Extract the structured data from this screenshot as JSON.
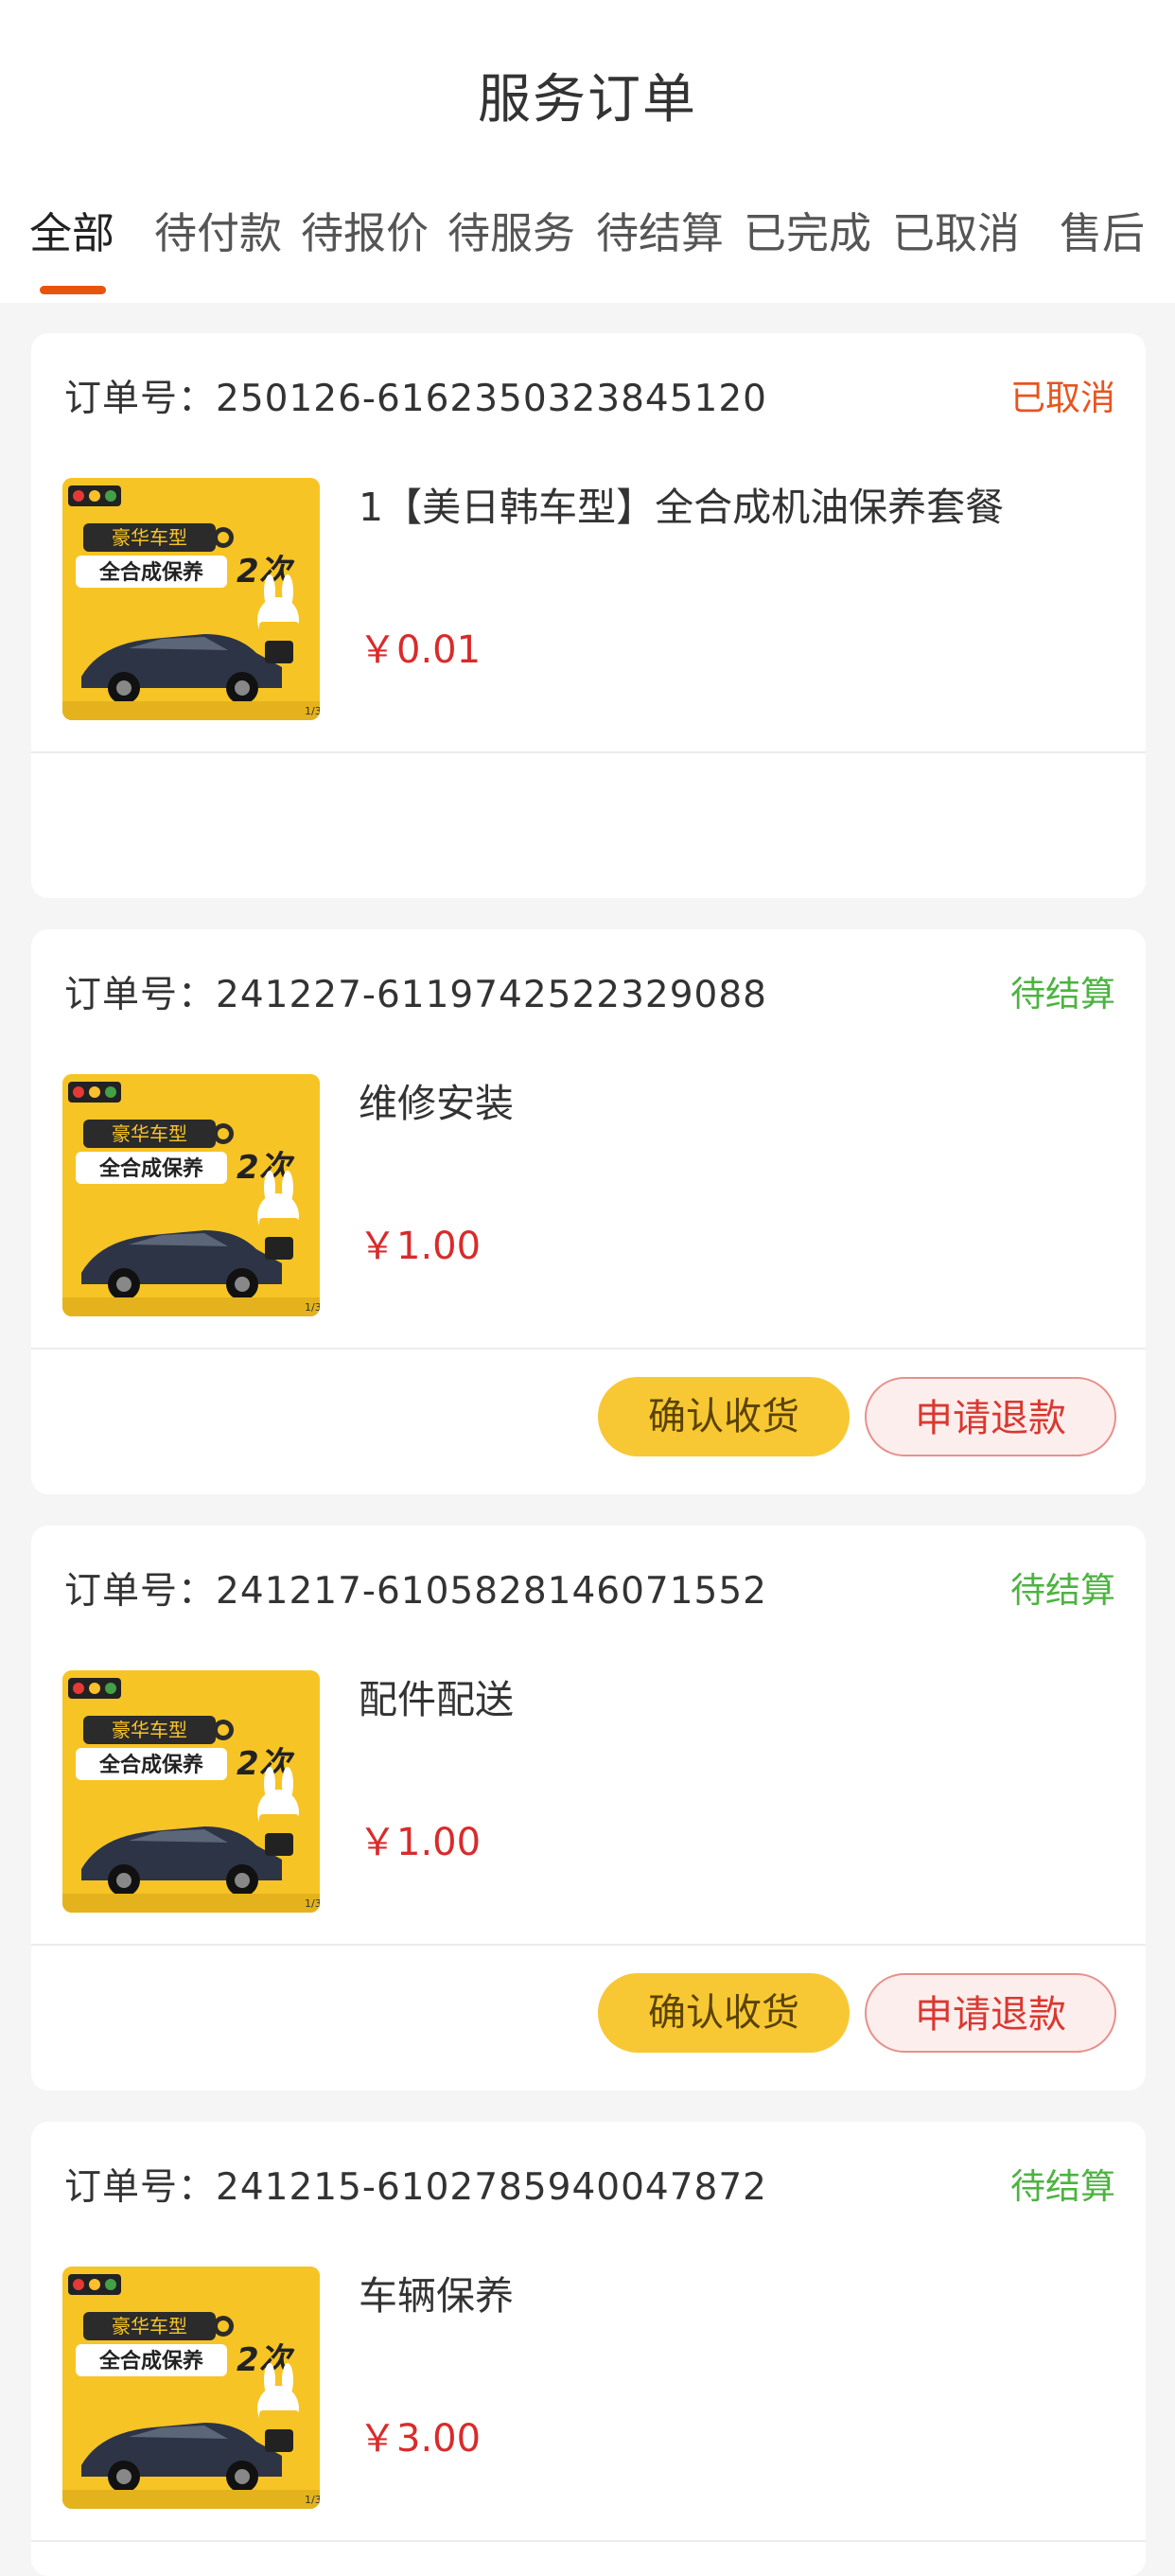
{
  "header": {
    "title": "服务订单"
  },
  "tabs": [
    {
      "label": "全部",
      "active": true
    },
    {
      "label": "待付款",
      "active": false
    },
    {
      "label": "待报价",
      "active": false
    },
    {
      "label": "待服务",
      "active": false
    },
    {
      "label": "待结算",
      "active": false
    },
    {
      "label": "已完成",
      "active": false
    },
    {
      "label": "已取消",
      "active": false
    },
    {
      "label": "售后",
      "active": false
    }
  ],
  "colors": {
    "accent": "#e8540e",
    "cancelled": "#e8541e",
    "pending_settlement": "#4cb340",
    "price": "#d92b2b",
    "confirm_button": "#f8c834",
    "refund_button_text": "#d9382f"
  },
  "product_image": {
    "badge": "豪华车型",
    "headline": "全合成保养",
    "count": "2次",
    "page": "1/3"
  },
  "orders": [
    {
      "order_no": "订单号：250126-6162350323845120",
      "status": "已取消",
      "product_name": "1【美日韩车型】全合成机油保养套餐",
      "price": "￥0.01"
    },
    {
      "order_no": "订单号：241227-6119742522329088",
      "status": "待结算",
      "product_name": "维修安装",
      "price": "￥1.00",
      "actions": {
        "confirm": "确认收货",
        "refund": "申请退款"
      }
    },
    {
      "order_no": "订单号：241217-6105828146071552",
      "status": "待结算",
      "product_name": "配件配送",
      "price": "￥1.00",
      "actions": {
        "confirm": "确认收货",
        "refund": "申请退款"
      }
    },
    {
      "order_no": "订单号：241215-6102785940047872",
      "status": "待结算",
      "product_name": "车辆保养",
      "price": "￥3.00"
    }
  ]
}
